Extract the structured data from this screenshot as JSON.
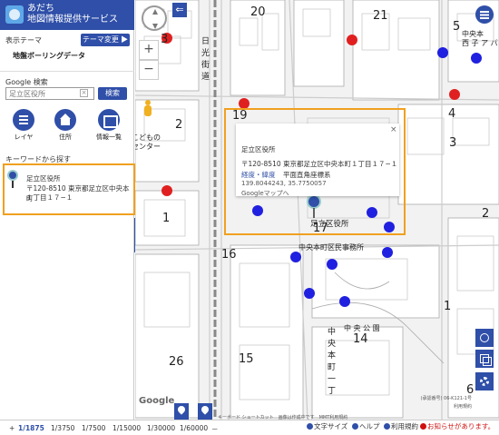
{
  "header": {
    "title_line1": "あだち",
    "title_line2": "地図情報提供サービス"
  },
  "theme": {
    "label": "表示テーマ",
    "change_button": "テーマ変更 ▶",
    "name": "地盤ボーリングデータ"
  },
  "search": {
    "label": "Google 検索",
    "placeholder": "足立区役所",
    "clear": "×",
    "button": "検索"
  },
  "tools": [
    {
      "label": "レイヤ",
      "icon": "layer-icon"
    },
    {
      "label": "住所",
      "icon": "home-icon"
    },
    {
      "label": "情報一覧",
      "icon": "list-icon"
    }
  ],
  "keyword": {
    "label": "キーワードから探す"
  },
  "result": {
    "name": "足立区役所",
    "address_line1": "〒120-8510 東京都足立区中央本町",
    "address_line2": "１丁目１７−１"
  },
  "collapse_tab": "«",
  "popup": {
    "title": "足立区役所",
    "address": "〒120-8510 東京都足立区中央本町１丁目１７−１",
    "latlng_link": "経度・緯度",
    "plane_label": "平面直角座標系",
    "coords": "139.8044243, 35.7750057",
    "googlemap": "Googleマップへ",
    "close": "×"
  },
  "map": {
    "block_numbers": [
      "20",
      "21",
      "5",
      "3",
      "2",
      "19",
      "4",
      "3",
      "1",
      "17",
      "16",
      "1",
      "2",
      "14",
      "15",
      "26",
      "6"
    ],
    "labels": {
      "building": "足立区役所",
      "court": "中央本町区民事務所",
      "park": "中 央 公 園",
      "street": "中央本町一丁",
      "highway": "日光街道",
      "kaido": "旧日光街道",
      "center": "センター",
      "kodomo": "こどもの",
      "top_right": "中央本",
      "top_right_2": "西 子 ア パ"
    },
    "attribution_line1": "(承認番号)",
    "attribution_line2": "06-K121-1号",
    "attribution_line3": "利用規約",
    "terms": "キーボード ショートカット　画像は作成中です　MMT利用規約",
    "google": "Google"
  },
  "scale": {
    "plus": "+",
    "items": [
      "1/1875",
      "1/3750",
      "1/7500",
      "1/15000",
      "1/30000",
      "1/60000",
      "－"
    ],
    "active_index": 0
  },
  "footer": {
    "font_size": "文字サイズ",
    "help": "ヘルプ",
    "terms": "利用規約",
    "notice": "お知らせがあります。"
  },
  "colors": {
    "brand": "#2f4fa8",
    "highlight": "#f0a020",
    "red_marker": "#e02020",
    "blue_marker": "#2020e0"
  }
}
